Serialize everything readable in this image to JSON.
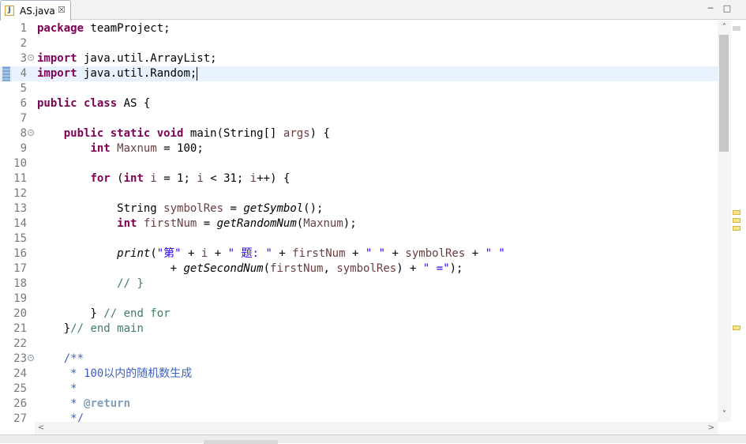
{
  "tab": {
    "icon": "java-file-icon",
    "title": "AS.java",
    "close_glyph": "☒"
  },
  "window": {
    "minimize_glyph": "─",
    "maximize_glyph": "□"
  },
  "editor": {
    "current_line": 4,
    "lines": [
      {
        "n": "1",
        "fold": false,
        "html": "<span class=\"kw\">package</span> teamProject;"
      },
      {
        "n": "2",
        "fold": false,
        "html": ""
      },
      {
        "n": "3",
        "fold": true,
        "html": "<span class=\"kw\">import</span> java.util.ArrayList;"
      },
      {
        "n": "4",
        "fold": false,
        "html": "<span class=\"kw\">import</span> java.util.Random;<span class=\"caret\"></span>"
      },
      {
        "n": "5",
        "fold": false,
        "html": ""
      },
      {
        "n": "6",
        "fold": false,
        "html": "<span class=\"kw\">public</span> <span class=\"kw\">class</span> AS {"
      },
      {
        "n": "7",
        "fold": false,
        "html": ""
      },
      {
        "n": "8",
        "fold": true,
        "html": "    <span class=\"kw\">public</span> <span class=\"kw\">static</span> <span class=\"kw\">void</span> main(String[] <span class=\"var\">args</span>) {"
      },
      {
        "n": "9",
        "fold": false,
        "html": "        <span class=\"kw\">int</span> <span class=\"var\">Maxnum</span> = 100;"
      },
      {
        "n": "10",
        "fold": false,
        "html": ""
      },
      {
        "n": "11",
        "fold": false,
        "html": "        <span class=\"kw\">for</span> (<span class=\"kw\">int</span> <span class=\"var\">i</span> = 1; <span class=\"var\">i</span> &lt; 31; <span class=\"var\">i</span>++) {"
      },
      {
        "n": "12",
        "fold": false,
        "html": ""
      },
      {
        "n": "13",
        "fold": false,
        "html": "            String <span class=\"var\">symbolRes</span> = <span class=\"it\">getSymbol</span>();"
      },
      {
        "n": "14",
        "fold": false,
        "html": "            <span class=\"kw\">int</span> <span class=\"var\">firstNum</span> = <span class=\"it\">getRandomNum</span>(<span class=\"var\">Maxnum</span>);"
      },
      {
        "n": "15",
        "fold": false,
        "html": ""
      },
      {
        "n": "16",
        "fold": false,
        "html": "            <span class=\"it\">print</span>(<span class=\"str\">\"第\"</span> + <span class=\"var\">i</span> + <span class=\"str\">\" 题: \"</span> + <span class=\"var\">firstNum</span> + <span class=\"str\">\" \"</span> + <span class=\"var\">symbolRes</span> + <span class=\"str\">\" \"</span>"
      },
      {
        "n": "17",
        "fold": false,
        "html": "                    + <span class=\"it\">getSecondNum</span>(<span class=\"var\">firstNum</span>, <span class=\"var\">symbolRes</span>) + <span class=\"str\">\" =\"</span>);"
      },
      {
        "n": "18",
        "fold": false,
        "html": "            <span class=\"cmt\">// }</span>"
      },
      {
        "n": "19",
        "fold": false,
        "html": ""
      },
      {
        "n": "20",
        "fold": false,
        "html": "        } <span class=\"cmt\">// end for</span>"
      },
      {
        "n": "21",
        "fold": false,
        "html": "    }<span class=\"cmt\">// end main</span>"
      },
      {
        "n": "22",
        "fold": false,
        "html": ""
      },
      {
        "n": "23",
        "fold": true,
        "html": "    <span class=\"jd\">/**</span>"
      },
      {
        "n": "24",
        "fold": false,
        "html": "     <span class=\"jd\">* 100以内的随机数生成</span>"
      },
      {
        "n": "25",
        "fold": false,
        "html": "     <span class=\"jd\">*</span>"
      },
      {
        "n": "26",
        "fold": false,
        "html": "     <span class=\"jd\">* </span><span class=\"jdtag\">@return</span>"
      },
      {
        "n": "27",
        "fold": false,
        "html": "     <span class=\"jd\">*/</span>"
      }
    ]
  },
  "scroll": {
    "up_glyph": "˄",
    "down_glyph": "˅",
    "left_glyph": "<",
    "right_glyph": ">"
  }
}
